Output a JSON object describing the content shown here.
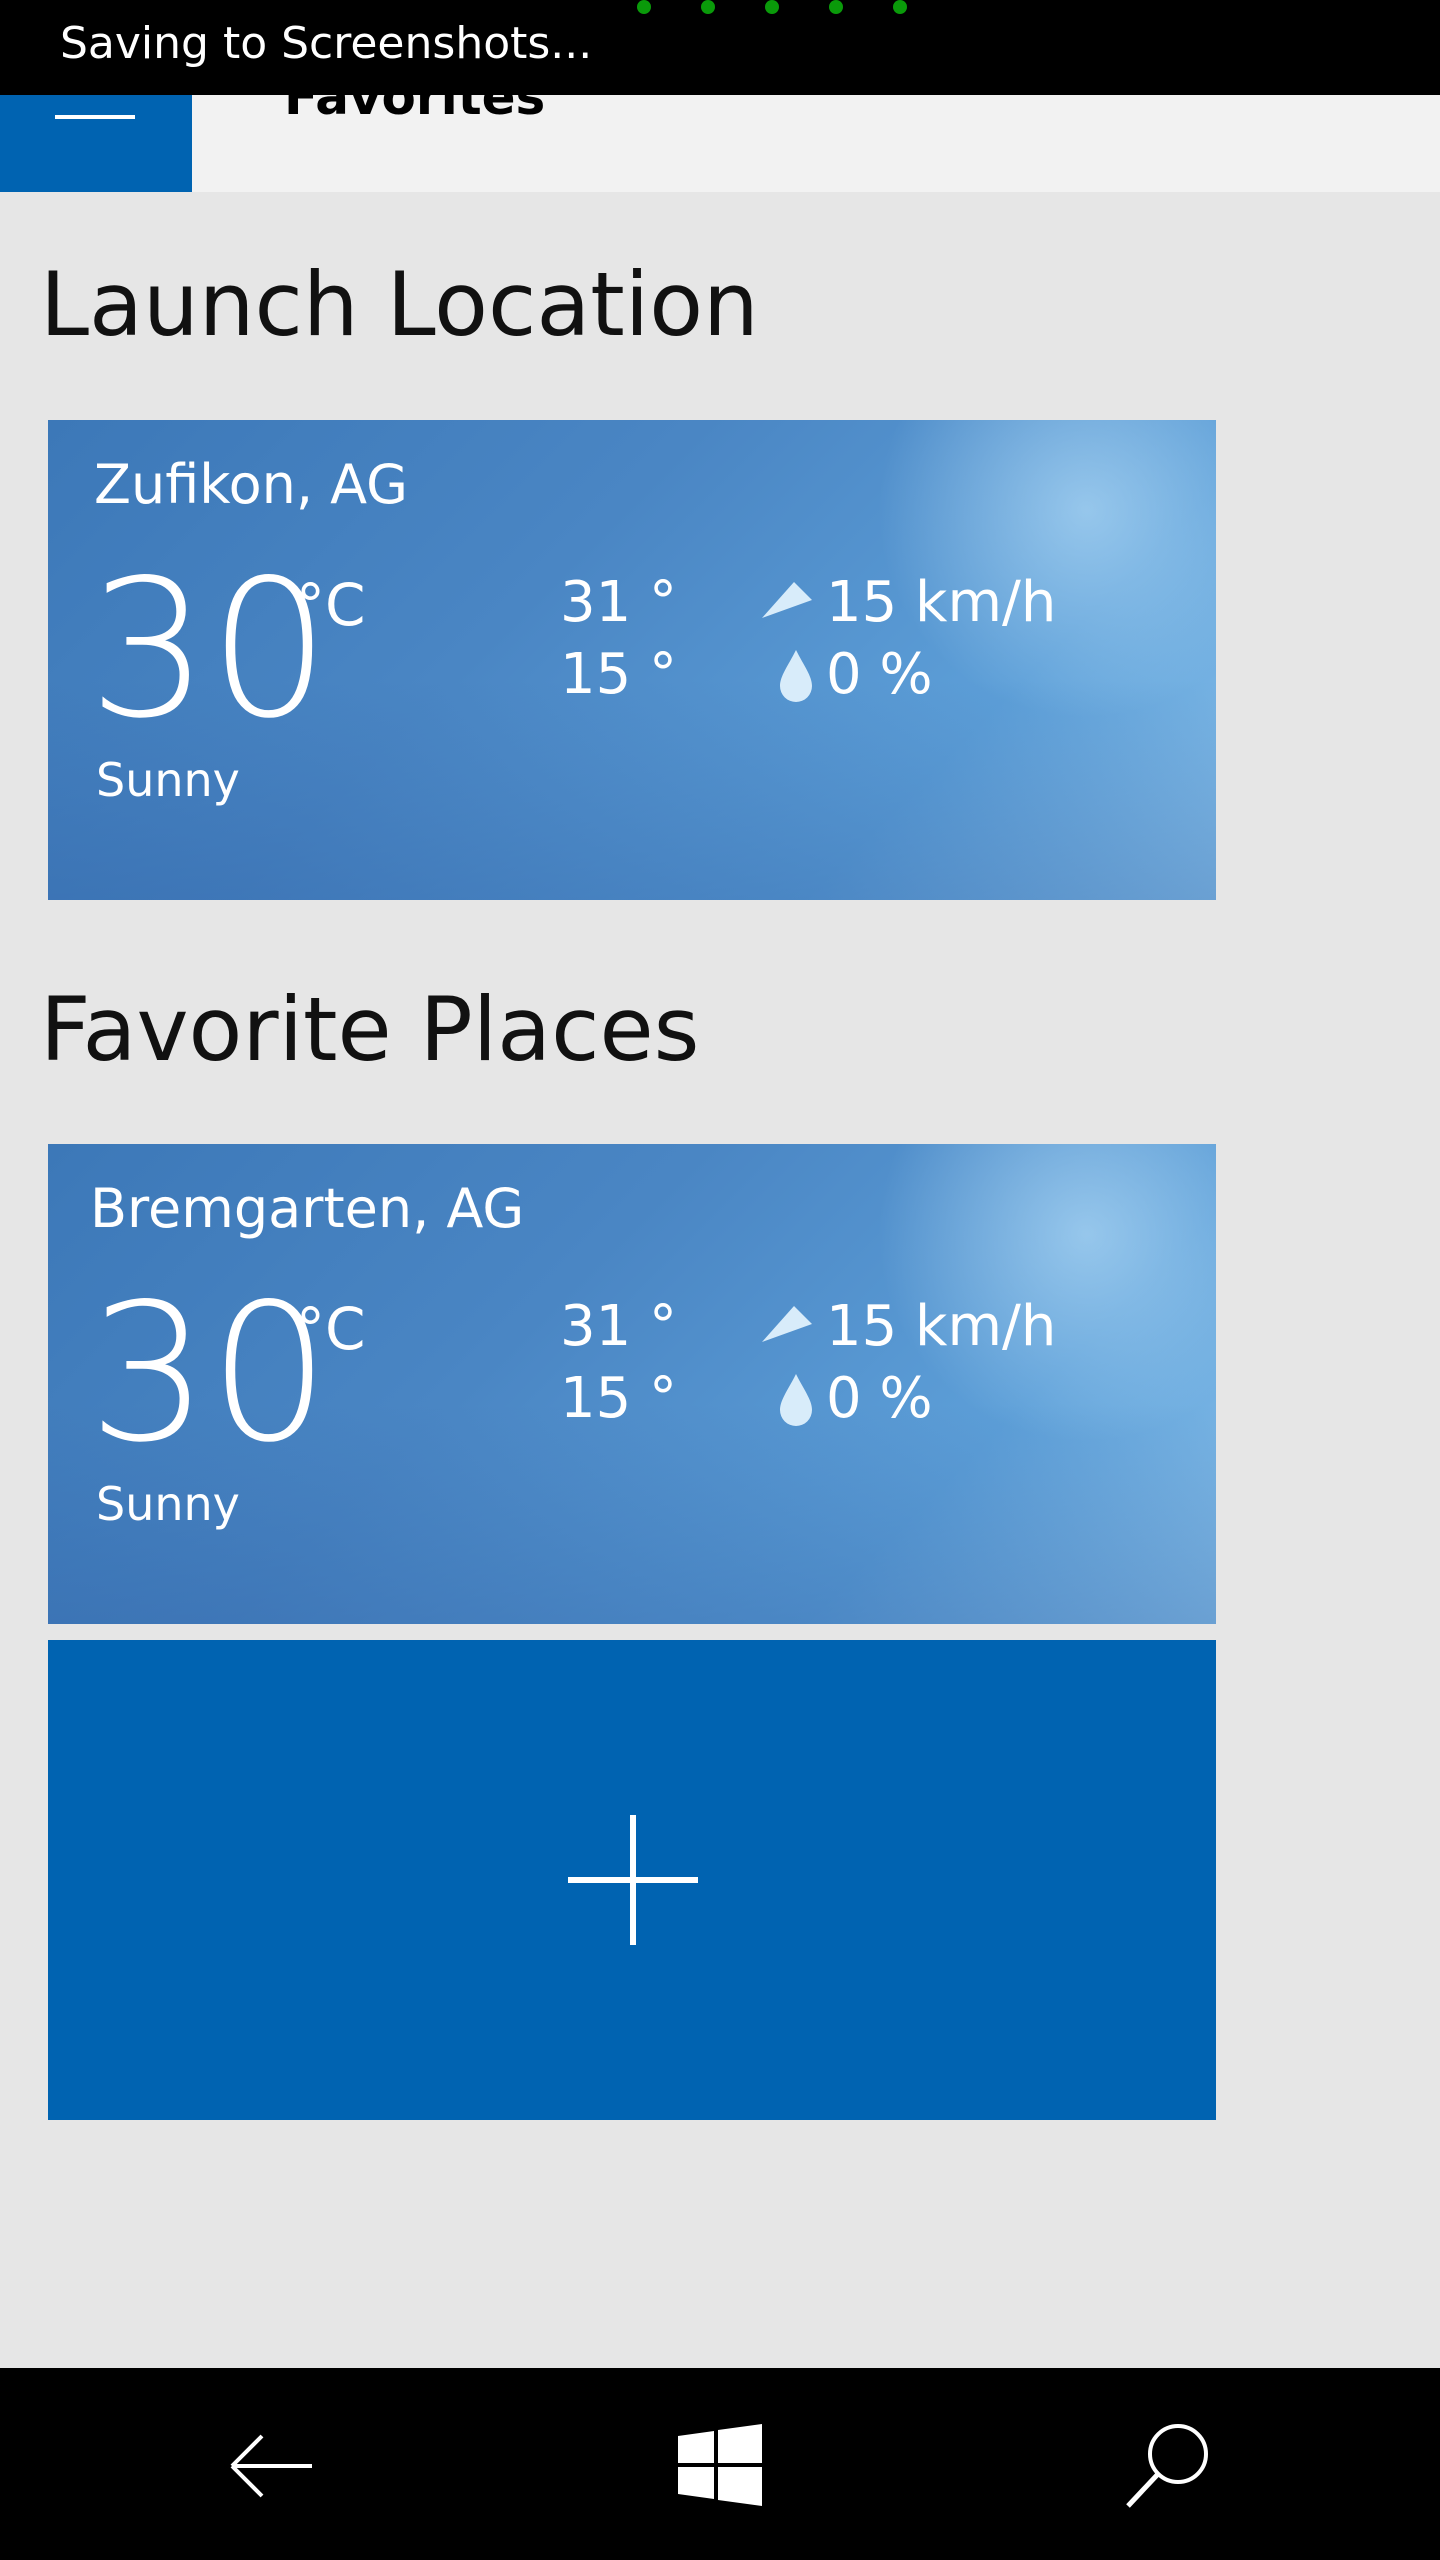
{
  "toast": {
    "text": "Saving to Screenshots..."
  },
  "header": {
    "title": "Favorites"
  },
  "launch": {
    "heading": "Launch Location",
    "card": {
      "city": "Zufikon, AG",
      "temp": "30",
      "unit": "°C",
      "condition": "Sunny",
      "high": "31 °",
      "low": "15 °",
      "wind": "15 km/h",
      "precip": "0 %"
    }
  },
  "favorites": {
    "heading": "Favorite Places",
    "cards": [
      {
        "city": "Bremgarten, AG",
        "temp": "30",
        "unit": "°C",
        "condition": "Sunny",
        "high": "31 °",
        "low": "15 °",
        "wind": "15 km/h",
        "precip": "0 %"
      }
    ],
    "add_icon": "plus-icon"
  },
  "navbar": {
    "icons": [
      "back-arrow-icon",
      "windows-logo-icon",
      "search-icon"
    ]
  },
  "colors": {
    "accent": "#0063b1",
    "toast_bg": "#000000",
    "page_bg": "#e6e6e6"
  }
}
